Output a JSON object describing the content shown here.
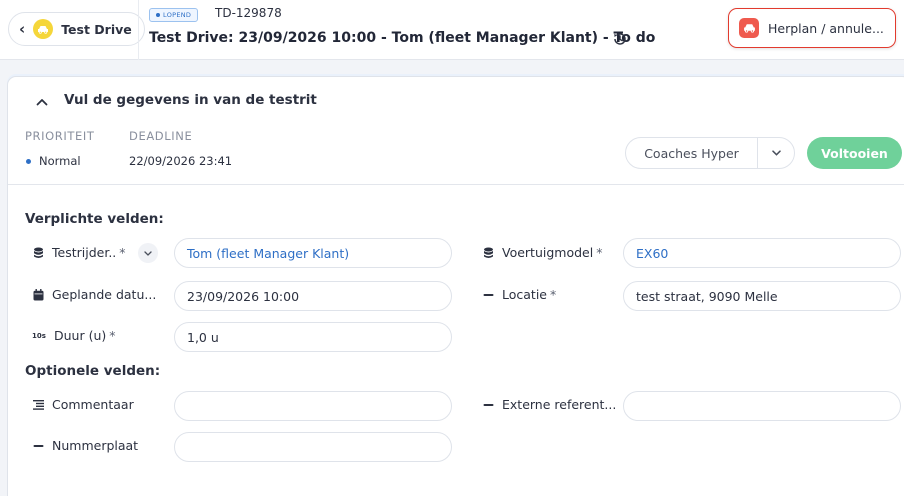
{
  "header": {
    "back_label": "Test Drive",
    "status_badge": "LOPEND",
    "reference_id": "TD-129878",
    "title": "Test Drive: 23/09/2026 10:00 - Tom (fleet Manager Klant) - To do",
    "reschedule_label": "Herplan / annule..."
  },
  "section": {
    "title": "Vul de gegevens in van de testrit",
    "priority_label": "PRIORITEIT",
    "priority_value": "Normal",
    "deadline_label": "DEADLINE",
    "deadline_value": "22/09/2026 23:41",
    "coach_button": "Coaches Hyper",
    "finish_button": "Voltooien"
  },
  "required": {
    "title": "Verplichte velden:",
    "fields": {
      "test_driver": {
        "label": "Testrijder..",
        "value": "Tom (fleet Manager Klant)"
      },
      "planned_date": {
        "label": "Geplande datu...",
        "value": "23/09/2026 10:00"
      },
      "duration": {
        "label": "Duur (u)",
        "value": "1,0 u"
      },
      "vehicle_model": {
        "label": "Voertuigmodel",
        "value": "EX60"
      },
      "location": {
        "label": "Locatie",
        "value": "test straat, 9090 Melle"
      }
    },
    "required_mark": "*",
    "duration_icon_text": "10s"
  },
  "optional": {
    "title": "Optionele velden:",
    "fields": {
      "comment": {
        "label": "Commentaar",
        "value": ""
      },
      "license_plate": {
        "label": "Nummerplaat",
        "value": ""
      },
      "external_ref": {
        "label": "Externe referent...",
        "value": ""
      }
    }
  },
  "colors": {
    "accent": "#2e6fc6",
    "finish": "#6fd19a",
    "danger": "#e23b2e",
    "car_badge": "#f5d63a"
  }
}
